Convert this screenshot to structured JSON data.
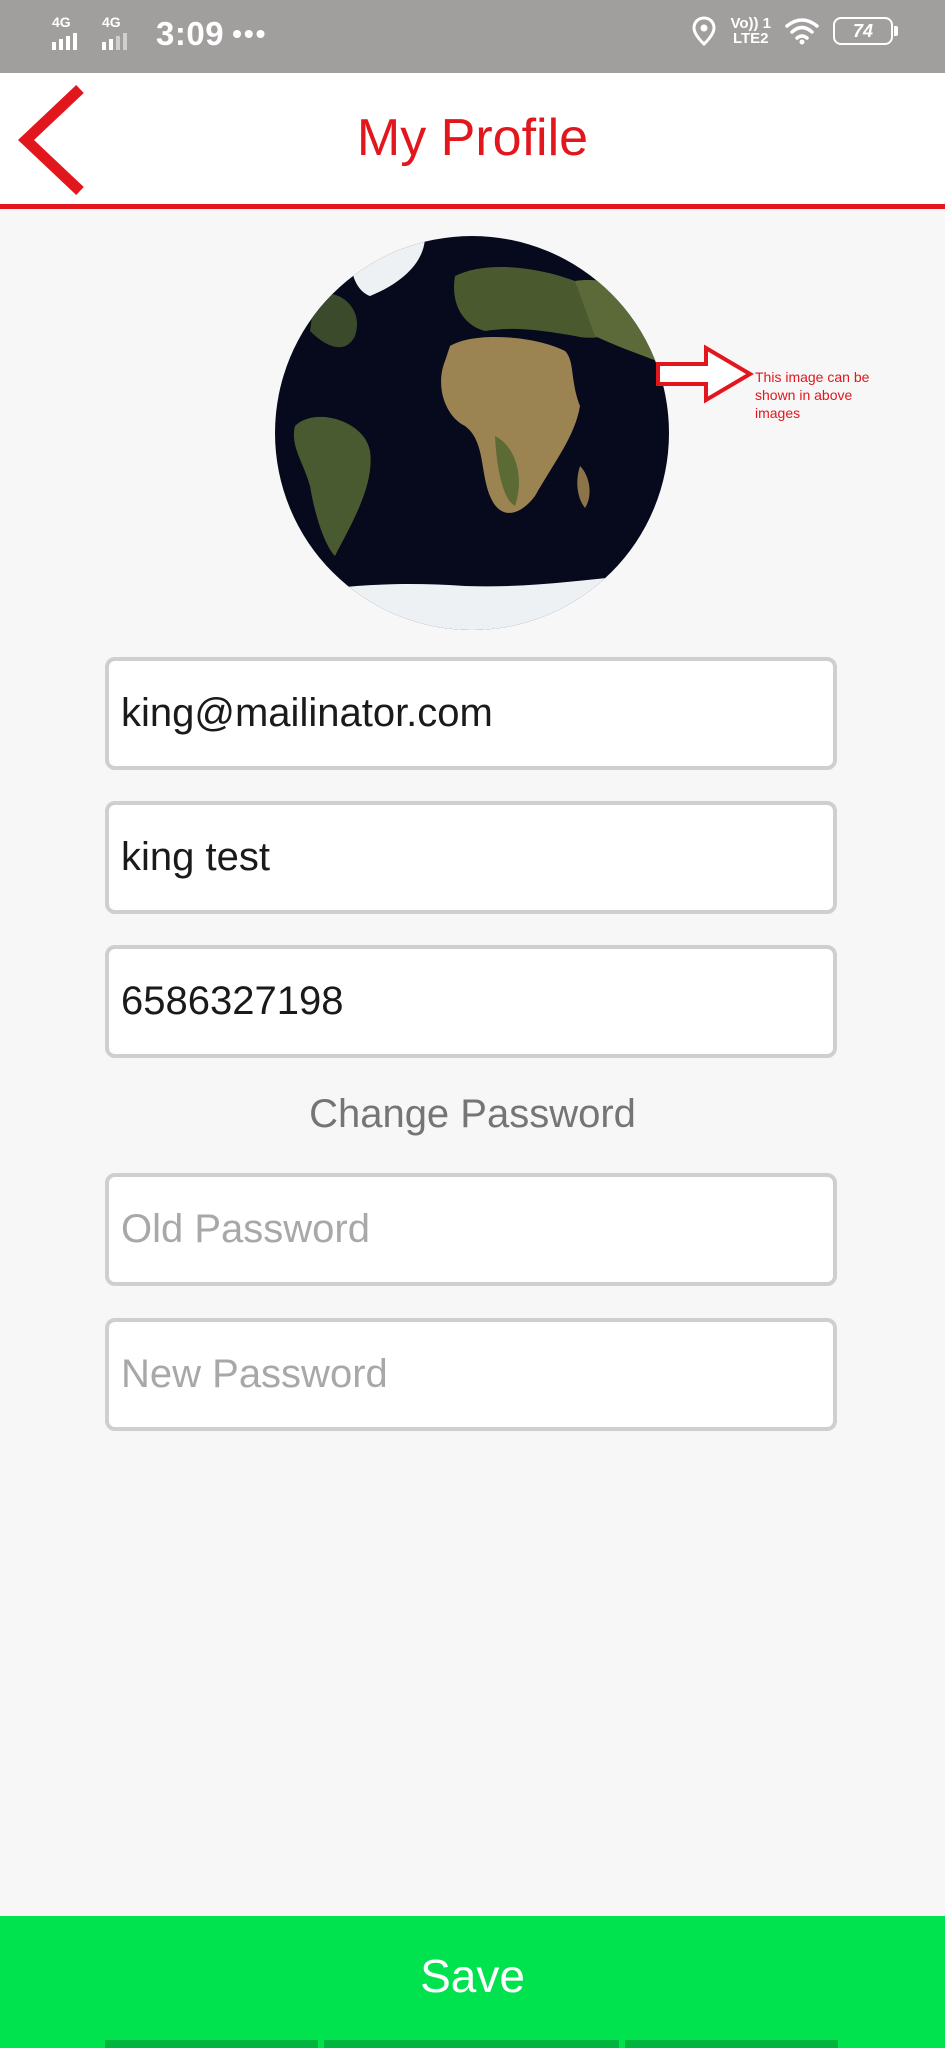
{
  "status_bar": {
    "network_1": "4G",
    "network_2": "4G",
    "time": "3:09",
    "more": "•••",
    "volte_line1": "Vo)) 1",
    "volte_line2": "LTE2",
    "battery_level": "74"
  },
  "header": {
    "title": "My Profile",
    "back_icon": "chevron-left-icon"
  },
  "avatar": {
    "icon": "earth-globe-image"
  },
  "annotation": {
    "text": "This image can be shown in above images"
  },
  "form": {
    "email": {
      "value": "king@mailinator.com"
    },
    "name": {
      "value": "king test"
    },
    "phone": {
      "value": "6586327198"
    },
    "change_password_label": "Change Password",
    "old_password": {
      "placeholder": "Old Password"
    },
    "new_password": {
      "placeholder": "New Password"
    }
  },
  "actions": {
    "save_label": "Save"
  },
  "colors": {
    "accent": "#e2171e",
    "save": "#00e34f",
    "status_bar": "#a19e9e"
  }
}
